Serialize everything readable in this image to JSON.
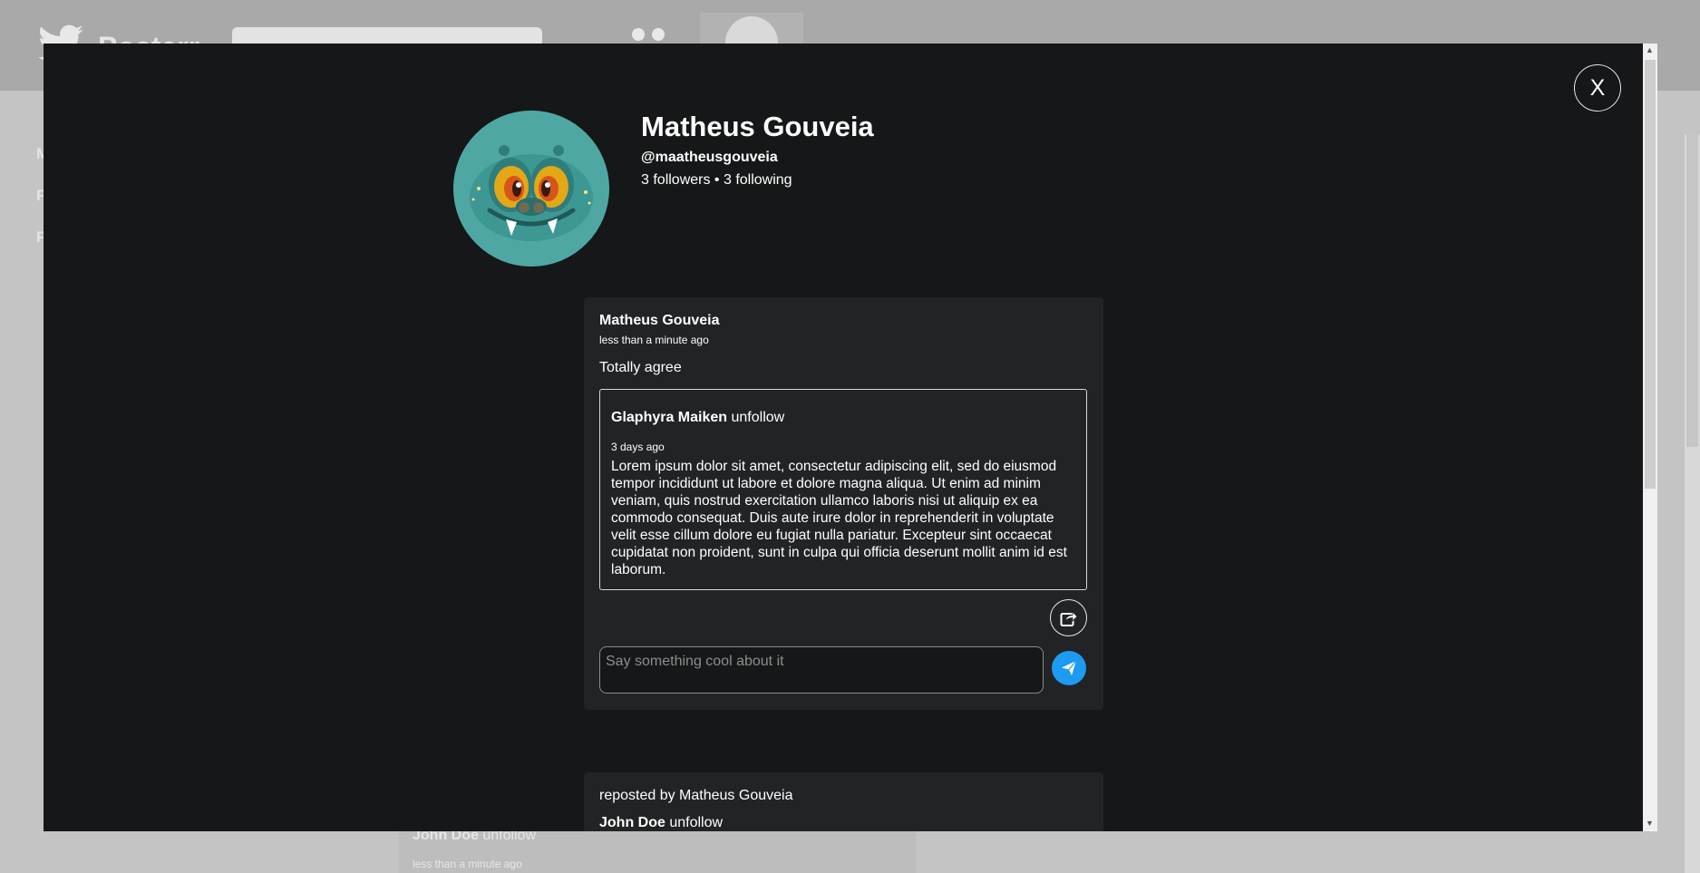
{
  "background": {
    "brand": "Posterr",
    "nav_letters": [
      "M",
      "F",
      "F"
    ],
    "feed_author": "John Doe",
    "feed_follow": "unfollow",
    "feed_time": "less than a minute ago"
  },
  "modal": {
    "close_label": "X",
    "profile": {
      "name": "Matheus Gouveia",
      "handle": "@maatheusgouveia",
      "stats": "3 followers • 3 following"
    },
    "post": {
      "author": "Matheus Gouveia",
      "time": "less than a minute ago",
      "text": "Totally agree",
      "quote": {
        "author": "Glaphyra Maiken",
        "follow": "unfollow",
        "time": "3 days ago",
        "body": "Lorem ipsum dolor sit amet, consectetur adipiscing elit, sed do eiusmod tempor incididunt ut labore et dolore magna aliqua. Ut enim ad minim veniam, quis nostrud exercitation ullamco laboris nisi ut aliquip ex ea commodo consequat. Duis aute irure dolor in reprehenderit in voluptate velit esse cillum dolore eu fugiat nulla pariatur. Excepteur sint occaecat cupidatat non proident, sunt in culpa qui officia deserunt mollit anim id est laborum."
      },
      "comment_placeholder": "Say something cool about it"
    },
    "repost": {
      "label": "reposted by Matheus Gouveia",
      "author": "John Doe",
      "follow": "unfollow"
    }
  },
  "colors": {
    "modal_bg": "#161718",
    "card_bg": "#222325",
    "accent": "#1d9bf0",
    "avatar_bg": "#4fa7a4"
  },
  "icons": [
    "twitter-bird-icon",
    "users-icon",
    "close-icon",
    "share-icon",
    "send-icon"
  ]
}
